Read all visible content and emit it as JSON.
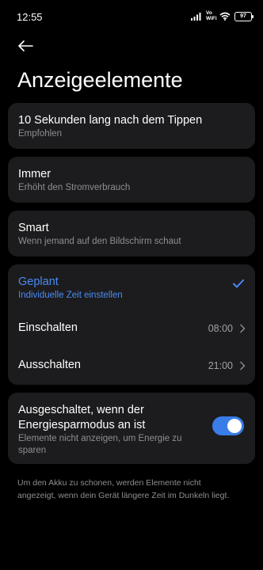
{
  "status_bar": {
    "time": "12:55",
    "network_label_1": "Vo",
    "network_label_2": "WiFi",
    "battery": "97"
  },
  "header": {
    "title": "Anzeigeelemente"
  },
  "options": [
    {
      "title": "10 Sekunden lang nach dem Tippen",
      "subtitle": "Empfohlen"
    },
    {
      "title": "Immer",
      "subtitle": "Erhöht den Stromverbrauch"
    },
    {
      "title": "Smart",
      "subtitle": "Wenn jemand auf den Bildschirm schaut"
    }
  ],
  "scheduled": {
    "title": "Geplant",
    "subtitle": "Individuelle Zeit einstellen",
    "selected": true,
    "accent_color": "#4a8bf5",
    "on": {
      "label": "Einschalten",
      "value": "08:00"
    },
    "off": {
      "label": "Ausschalten",
      "value": "21:00"
    }
  },
  "power_saving": {
    "title_line1": "Ausgeschaltet, wenn der",
    "title_line2": "Energiesparmodus an ist",
    "subtitle_line1": "Elemente nicht anzeigen, um Energie zu",
    "subtitle_line2": "sparen",
    "enabled": true
  },
  "footer": {
    "line1": "Um den Akku zu schonen, werden Elemente nicht",
    "line2": "angezeigt, wenn dein Gerät längere Zeit im Dunkeln liegt."
  }
}
